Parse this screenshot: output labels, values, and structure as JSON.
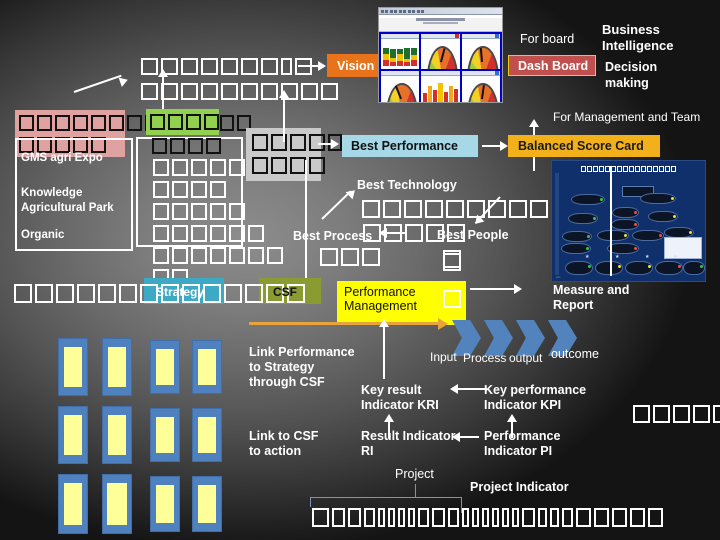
{
  "slide": {
    "title_context": "Strategy to Performance Management framework",
    "background_note": "dark gray radial gradient"
  },
  "colors": {
    "vision": "#e8731a",
    "dashboard": "#c0504d",
    "dashboard_border": "#f0c419",
    "best_performance": "#a6d8e7",
    "balanced_score_card": "#f2b11b",
    "strategy": "#3ea9c4",
    "csf": "#8a9b31",
    "performance_management": "#ffff00",
    "pink_panel": "#e0a2a0",
    "green_panel": "#92d050",
    "gray_panel": "#c9c9c9",
    "card_blue": "#4e81bd",
    "card_yellow": "#ffff99",
    "chevron": "#5383bd",
    "gold_arrow": "#e8a33d"
  },
  "boxes": {
    "vision": "Vision",
    "dash_board": "Dash Board",
    "best_performance": "Best Performance",
    "balanced_score_card": "Balanced Score Card",
    "strategy": "Strategy",
    "csf": "CSF",
    "performance_management_line1": "Performance",
    "performance_management_line2": "Management"
  },
  "labels": {
    "for_board": "For board",
    "business_intelligence_line1": "Business",
    "business_intelligence_line2": "Intelligence",
    "decision_making_line1": "Decision",
    "decision_making_line2": "making",
    "for_management_and_team": "For Management and Team",
    "best_technology": "Best  Technology",
    "best_process": "Best  Process",
    "best_people": "Best  People",
    "measure_and_report_line1": "Measure and",
    "measure_and_report_line2": "Report",
    "link_performance_line1": "Link Performance",
    "link_performance_line2": "to Strategy",
    "link_performance_line3": "through CSF",
    "link_to_csf_line1": "Link to CSF",
    "link_to_csf_line2": "to action",
    "input": "Input",
    "process": "Process",
    "output": "output",
    "outcome": "outcome",
    "key_result_indicator_line1": "Key result",
    "key_result_indicator_line2": "Indicator KRI",
    "key_performance_indicator_line1": "Key performance",
    "key_performance_indicator_line2": "Indicator KPI",
    "result_indicator_line1": "Result Indicator",
    "result_indicator_line2": "RI",
    "performance_indicator_line1": "Performance",
    "performance_indicator_line2": "Indicator PI",
    "project": "Project",
    "project_indicator": "Project Indicator"
  },
  "left_panel": {
    "item1": "GMS agri Expo",
    "item2_line1": "Knowledge",
    "item2_line2": "Agricultural Park",
    "item3": "Organic"
  },
  "thai_placeholder_note": "Thai text rendered as missing-glyph boxes",
  "tofu_groups": {
    "top_row1": 9,
    "top_row2": 10,
    "pink_row1": 7,
    "pink_row2": 5,
    "black_row_after_pink": 2,
    "green_row": 5,
    "black_after_green": 2,
    "black_row2": 4,
    "gray_row1": 5,
    "gray_row2": 4,
    "white_panel_row1": 5,
    "white_panel_row2": 4,
    "white_panel_row3": 5,
    "white_panel_row4": 6,
    "white_panel_row5": 7,
    "white_panel_row6": 2,
    "tech_row": 9,
    "process_row": 5,
    "under_process_row": 3,
    "people_single": 1,
    "pm_side1": 1,
    "pm_side2": 1,
    "strategy_row": 12,
    "right_mid_row": 5,
    "bottom_row": 22
  },
  "dashboard_thumb": {
    "panels": 6,
    "types": [
      "stacked-bar",
      "gauge",
      "gauge",
      "gauge",
      "bar",
      "gauge"
    ]
  },
  "network_thumb": {
    "title_tofu_count": 16,
    "node_count": 19
  },
  "project_grid": {
    "rows": 3,
    "cols": 4
  }
}
